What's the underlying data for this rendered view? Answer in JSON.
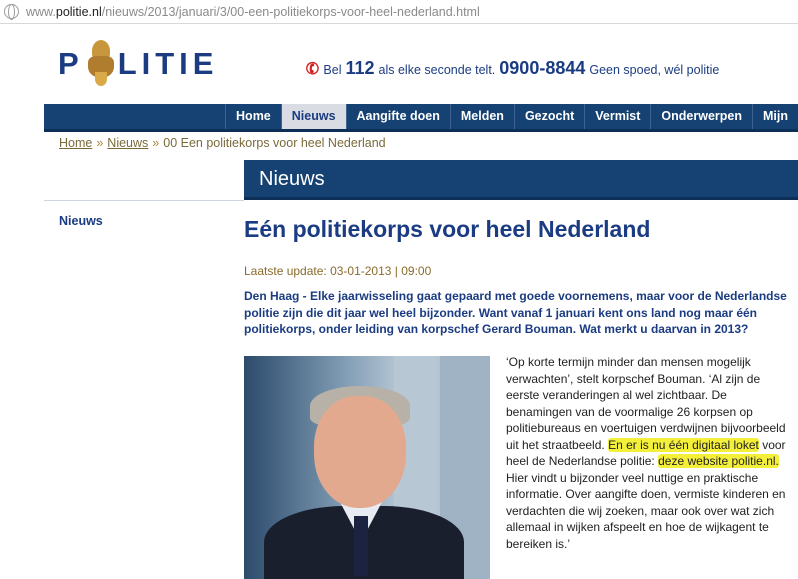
{
  "browser": {
    "url_prefix": "www.",
    "url_domain": "politie.nl",
    "url_path": "/nieuws/2013/januari/3/00-een-politiekorps-voor-heel-nederland.html"
  },
  "header": {
    "logo_left": "P",
    "logo_right": "LITIE",
    "phone_prefix": "Bel",
    "phone_emergency": "112",
    "phone_emergency_text": "als elke seconde telt.",
    "phone_regular": "0900-8844",
    "phone_regular_text": "Geen spoed, wél politie"
  },
  "nav": {
    "items": [
      "Home",
      "Nieuws",
      "Aangifte doen",
      "Melden",
      "Gezocht",
      "Vermist",
      "Onderwerpen",
      "Mijn"
    ],
    "active": "Nieuws"
  },
  "breadcrumb": {
    "home": "Home",
    "sep": "»",
    "news": "Nieuws",
    "current": "00 Een politiekorps voor heel Nederland"
  },
  "section": {
    "title": "Nieuws"
  },
  "sidebar": {
    "items": [
      "Nieuws"
    ]
  },
  "article": {
    "title": "Eén politiekorps voor heel Nederland",
    "updated": "Laatste update: 03-01-2013 | 09:00",
    "lead": "Den Haag - Elke jaarwisseling gaat gepaard met goede voornemens, maar voor de Nederlandse politie zijn die dit jaar wel heel bijzonder. Want vanaf 1 januari kent ons land nog maar één politiekorps, onder leiding van korpschef Gerard Bouman. Wat merkt u daarvan in 2013?",
    "body_1": "‘Op korte termijn minder dan mensen mogelijk verwachten’, stelt korpschef Bouman. ‘Al zijn de eerste veranderingen al wel zichtbaar. De benamingen van de voormalige 26 korpsen op politiebureaus en voertuigen verdwijnen bijvoorbeeld uit het straatbeeld.",
    "body_hl_1": "En er is nu één digitaal loket",
    "body_2": "voor heel de Nederlandse politie:",
    "body_hl_2": "deze website politie.nl.",
    "body_3": "Hier vindt u bijzonder veel nuttige en praktische informatie. Over aangifte doen, vermiste kinderen en verdachten die wij zoeken, maar ook over wat zich allemaal in wijken afspeelt en hoe de wijkagent te bereiken is.’"
  },
  "colors": {
    "brand_blue": "#154273",
    "highlight": "#f4f03a",
    "gold": "#8a6a2a"
  }
}
